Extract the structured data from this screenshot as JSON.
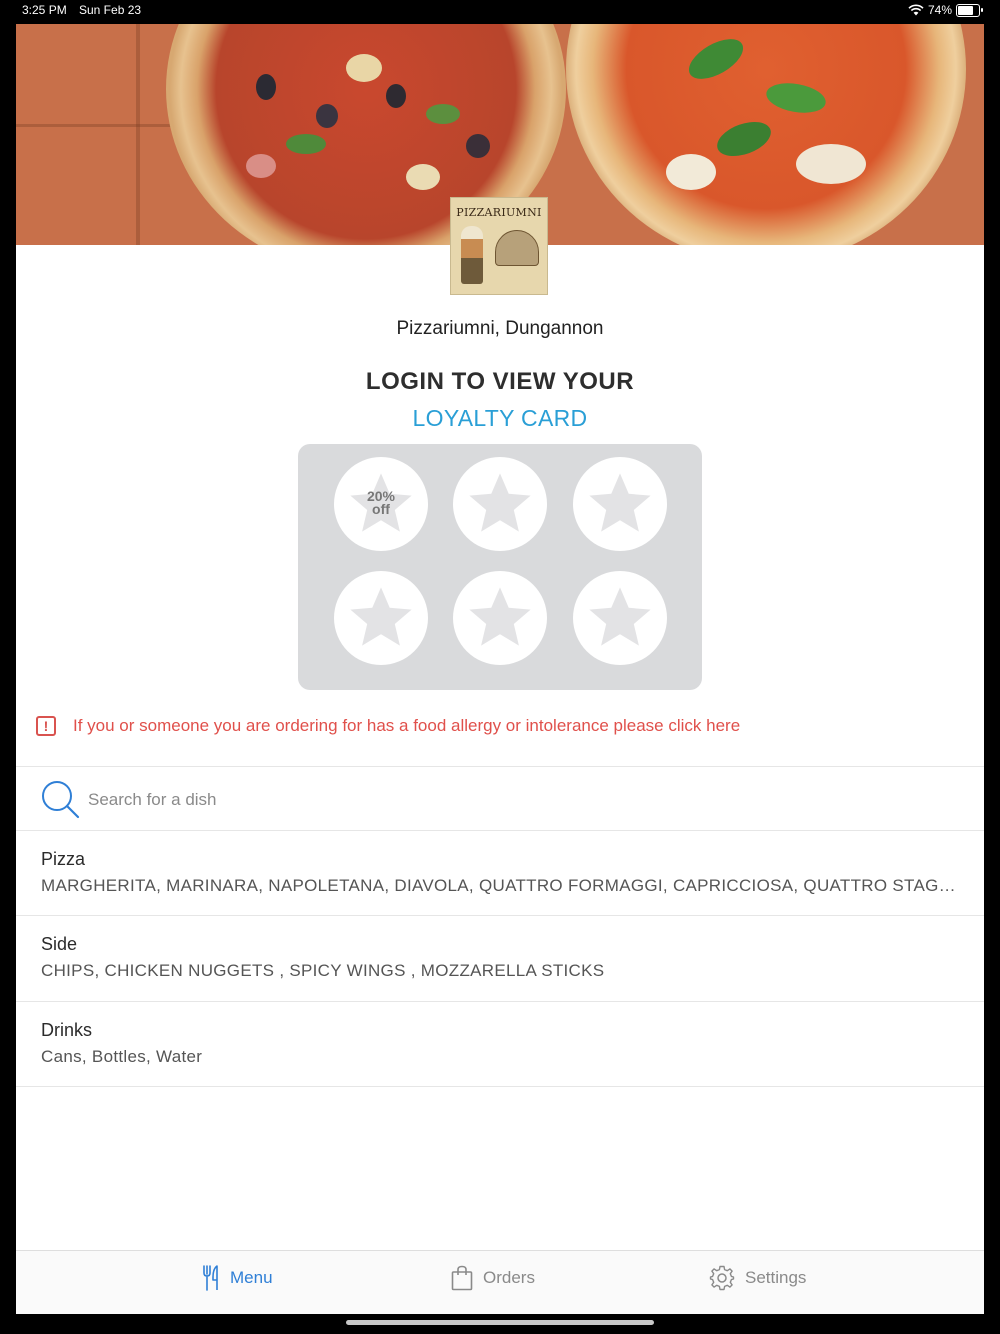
{
  "status_bar": {
    "time": "3:25 PM",
    "date": "Sun Feb 23",
    "battery": "74%",
    "battery_level": 0.74
  },
  "header": {
    "logo_text": "PIZZARIUMNI",
    "restaurant_name": "Pizzariumni, Dungannon"
  },
  "loyalty": {
    "title_line1": "LOGIN TO VIEW YOUR",
    "title_line2": "LOYALTY CARD",
    "stamps_total": 6,
    "stamps_collected": 0,
    "reward_text_line1": "20%",
    "reward_text_line2": "off",
    "reward_stamp_index": 1
  },
  "allergy_notice": {
    "text": "If you or someone you are ordering for has a food allergy or intolerance please click here",
    "color": "#e0504b"
  },
  "search": {
    "placeholder": "Search for a dish"
  },
  "menu": {
    "categories": [
      {
        "name": "Pizza",
        "items": "MARGHERITA, MARINARA, NAPOLETANA, DIAVOLA, QUATTRO FORMAGGI, CAPRICCIOSA, QUATTRO STAGIONI"
      },
      {
        "name": "Side",
        "items": "CHIPS, CHICKEN NUGGETS , SPICY WINGS  , MOZZARELLA STICKS"
      },
      {
        "name": "Drinks",
        "items": "Cans, Bottles, Water"
      }
    ]
  },
  "tabbar": {
    "menu_label": "Menu",
    "orders_label": "Orders",
    "settings_label": "Settings",
    "active_tab": "Menu"
  },
  "colors": {
    "accent_blue": "#2f7fd6",
    "loyalty_blue": "#2a9fd6",
    "warning_red": "#e0504b"
  }
}
